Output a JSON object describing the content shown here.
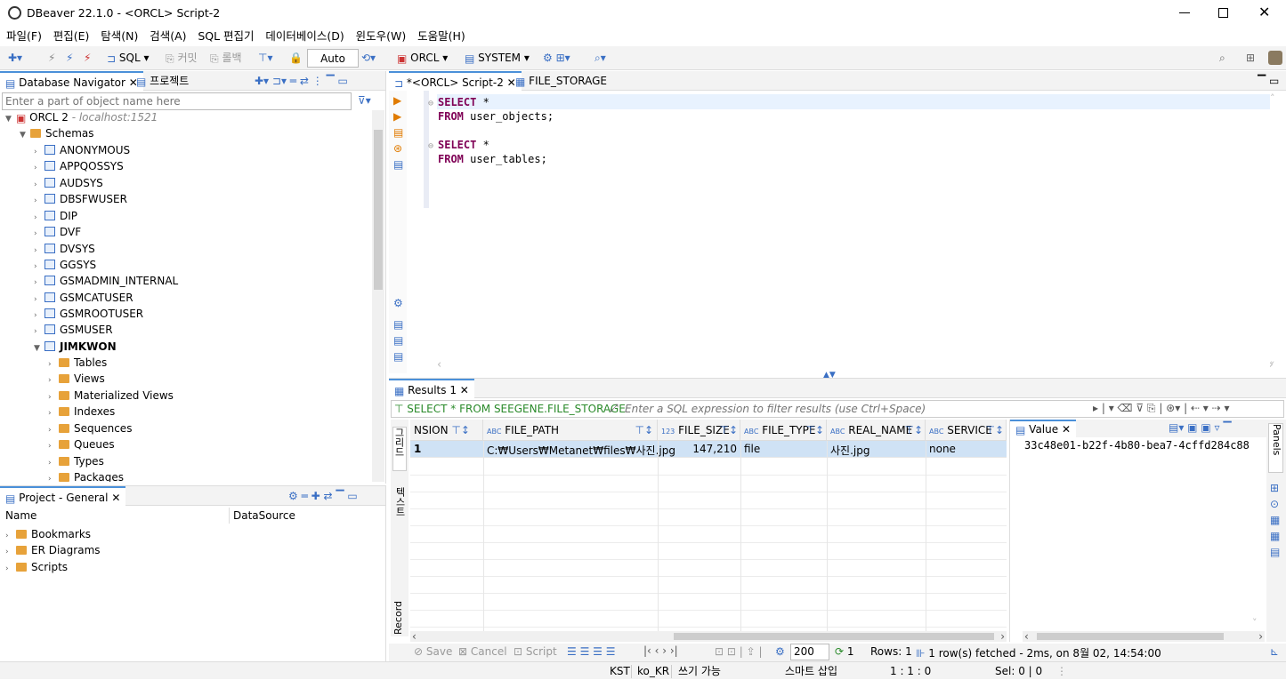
{
  "window": {
    "title": "DBeaver 22.1.0 - <ORCL> Script-2"
  },
  "menu": [
    "파일(F)",
    "편집(E)",
    "탐색(N)",
    "검색(A)",
    "SQL 편집기",
    "데이터베이스(D)",
    "윈도우(W)",
    "도움말(H)"
  ],
  "toolbar": {
    "sql_label": "SQL",
    "commit_label": "커밋",
    "rollback_label": "롤백",
    "auto_label": "Auto",
    "connection_label": "ORCL",
    "schema_label": "SYSTEM"
  },
  "navigator": {
    "tab_label": "Database Navigator",
    "tab2_label": "프로젝트",
    "filter_placeholder": "Enter a part of object name here",
    "connection": {
      "name": "ORCL 2",
      "host": "- localhost:1521"
    },
    "schemas_label": "Schemas",
    "schemas": [
      "ANONYMOUS",
      "APPQOSSYS",
      "AUDSYS",
      "DBSFWUSER",
      "DIP",
      "DVF",
      "DVSYS",
      "GGSYS",
      "GSMADMIN_INTERNAL",
      "GSMCATUSER",
      "GSMROOTUSER",
      "GSMUSER"
    ],
    "expanded_schema": "JIMKWON",
    "children": [
      "Tables",
      "Views",
      "Materialized Views",
      "Indexes",
      "Sequences",
      "Queues",
      "Types",
      "Packages"
    ]
  },
  "project": {
    "tab_label": "Project - General",
    "col_name": "Name",
    "col_datasource": "DataSource",
    "items": [
      "Bookmarks",
      "ER Diagrams",
      "Scripts"
    ]
  },
  "editor": {
    "tabs": [
      "*<ORCL> Script-2",
      "FILE_STORAGE"
    ],
    "lines": [
      {
        "kw": "SELECT",
        "rest": " *"
      },
      {
        "kw": "FROM",
        "rest": " user_objects;"
      },
      {
        "kw": "",
        "rest": ""
      },
      {
        "kw": "SELECT",
        "rest": " *"
      },
      {
        "kw": "FROM",
        "rest": " user_tables;"
      }
    ]
  },
  "results": {
    "tab_label": "Results 1",
    "query_label": "SELECT * FROM SEEGENE.FILE_STORAGE",
    "filter_placeholder": "Enter a SQL expression to filter results (use Ctrl+Space)",
    "side_tabs": [
      "그리드",
      "텍스트",
      "Record"
    ],
    "columns": [
      "NSION",
      "FILE_PATH",
      "FILE_SIZE",
      "FILE_TYPE",
      "REAL_NAME",
      "SERVICE"
    ],
    "column_types": [
      "",
      "ABC",
      "123",
      "ABC",
      "ABC",
      "ABC"
    ],
    "rows": [
      {
        "num": "1",
        "cells": [
          "",
          "C:₩Users₩Metanet₩files₩사진.jpg",
          "147,210",
          "file",
          "사진.jpg",
          "none"
        ]
      }
    ],
    "value_panel": {
      "tab_label": "Value",
      "value": "33c48e01-b22f-4b80-bea7-4cffd284c88"
    },
    "panels_label": "Panels",
    "bottom": {
      "save": "Save",
      "cancel": "Cancel",
      "script": "Script",
      "limit": "200",
      "refresh_count": "1",
      "rows_label": "Rows: 1",
      "fetched": "1 row(s) fetched - 2ms, on 8월 02, 14:54:00"
    }
  },
  "statusbar": {
    "tz": "KST",
    "locale": "ko_KR",
    "mode": "쓰기 가능",
    "insert": "스마트 삽입",
    "pos": "1 : 1 : 0",
    "sel": "Sel: 0 | 0"
  }
}
